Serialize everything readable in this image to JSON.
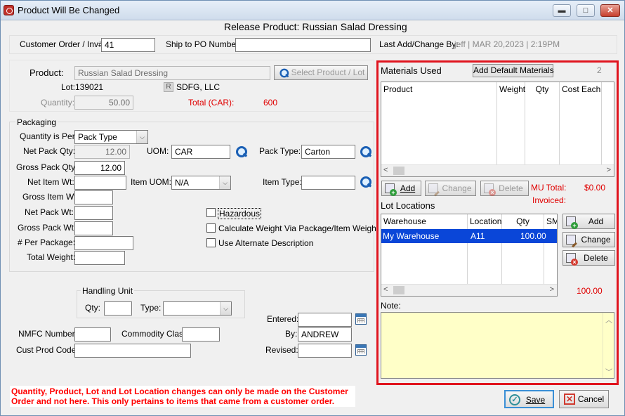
{
  "window": {
    "title": "Product Will Be Changed",
    "minimize_glyph": "▬",
    "maximize_glyph": "□",
    "close_glyph": "✕"
  },
  "heading": "Release Product: Russian Salad Dressing",
  "top_bar": {
    "customer_order_label": "Customer Order / Inv#:",
    "customer_order_value": "41",
    "ship_to_po_label": "Ship to PO Number:",
    "ship_to_po_value": "",
    "last_change_label": "Last Add/Change By:",
    "last_change_value": "jeff | MAR 20,2023 |  2:19PM"
  },
  "product": {
    "label": "Product:",
    "value": "Russian Salad Dressing",
    "select_button": "Select Product / Lot",
    "lot_label": "Lot:",
    "lot_value": "139021",
    "vendor_badge": "R",
    "vendor": "SDFG, LLC",
    "quantity_label": "Quantity:",
    "quantity_value": "50.00",
    "total_label": "Total (CAR):",
    "total_value": "600"
  },
  "packaging": {
    "legend": "Packaging",
    "qty_per_label": "Quantity is Per:",
    "qty_per_value": "Pack Type",
    "net_pack_qty_label": "Net Pack Qty:",
    "net_pack_qty_value": "12.00",
    "uom_label": "UOM:",
    "uom_value": "CAR",
    "pack_type_label": "Pack Type:",
    "pack_type_value": "Carton",
    "gross_pack_qty_label": "Gross Pack Qty:",
    "gross_pack_qty_value": "12.00",
    "net_item_wt_label": "Net Item Wt:",
    "net_item_wt_value": "",
    "item_uom_label": "Item UOM:",
    "item_uom_value": "N/A",
    "item_type_label": "Item Type:",
    "item_type_value": "",
    "gross_item_wt_label": "Gross Item Wt:",
    "net_pack_wt_label": "Net Pack Wt:",
    "gross_pack_wt_label": "Gross Pack Wt:",
    "per_package_label": "# Per Package:",
    "total_weight_label": "Total Weight:",
    "hazardous_label": "Hazardous",
    "calc_weight_label": "Calculate Weight Via Package/Item Weight",
    "alt_desc_label": "Use Alternate Description"
  },
  "handling_unit": {
    "legend": "Handling Unit",
    "qty_label": "Qty:",
    "type_label": "Type:"
  },
  "bottom_fields": {
    "nmfc_label": "NMFC Number:",
    "commodity_label": "Commodity Class:",
    "cust_prod_label": "Cust Prod Code:",
    "entered_label": "Entered:",
    "by_label": "By:",
    "by_value": "ANDREW",
    "revised_label": "Revised:"
  },
  "materials": {
    "title": "Materials Used",
    "add_default_button": "Add Default Materials",
    "count": "2",
    "columns": [
      "Product",
      "Weight",
      "Qty",
      "Cost Each"
    ],
    "add_button": "Add",
    "change_button": "Change",
    "delete_button": "Delete",
    "mu_total_label": "MU Total:",
    "mu_total_value": "$0.00",
    "invoiced_label": "Invoiced:"
  },
  "lot_locations": {
    "title": "Lot Locations",
    "columns": [
      "Warehouse",
      "Location",
      "Qty",
      "SM"
    ],
    "rows": [
      {
        "warehouse": "My Warehouse",
        "location": "A11",
        "qty": "100.00"
      }
    ],
    "add_button": "Add",
    "change_button": "Change",
    "delete_button": "Delete",
    "total": "100.00"
  },
  "note": {
    "label": "Note:",
    "value": ""
  },
  "warning": "Quantity, Product, Lot and Lot Location changes can only be made on the Customer Order and not here.  This only pertains to items that came from a customer order.",
  "buttons": {
    "save": "Save",
    "cancel": "Cancel"
  },
  "colors": {
    "highlight_border": "#e0141e",
    "selection": "#0a46d8",
    "note_bg": "#ffffc8",
    "warning_text": "#ff0000"
  }
}
